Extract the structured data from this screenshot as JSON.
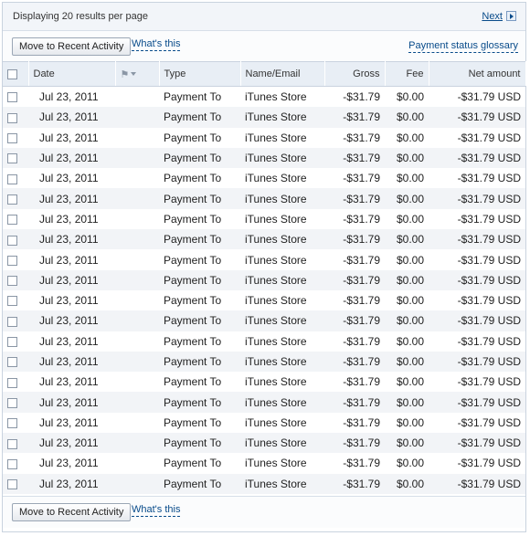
{
  "topbar": {
    "displaying": "Displaying 20 results per page",
    "next": "Next"
  },
  "actions": {
    "move_label": "Move to Recent Activity",
    "whats_this": "What's this",
    "glossary": "Payment status glossary"
  },
  "table": {
    "headers": {
      "date": "Date",
      "type": "Type",
      "name": "Name/Email",
      "gross": "Gross",
      "fee": "Fee",
      "net": "Net amount"
    },
    "rows": [
      {
        "date": "Jul 23, 2011",
        "type": "Payment To",
        "name": "iTunes Store",
        "gross": "-$31.79",
        "fee": "$0.00",
        "net": "-$31.79 USD"
      },
      {
        "date": "Jul 23, 2011",
        "type": "Payment To",
        "name": "iTunes Store",
        "gross": "-$31.79",
        "fee": "$0.00",
        "net": "-$31.79 USD"
      },
      {
        "date": "Jul 23, 2011",
        "type": "Payment To",
        "name": "iTunes Store",
        "gross": "-$31.79",
        "fee": "$0.00",
        "net": "-$31.79 USD"
      },
      {
        "date": "Jul 23, 2011",
        "type": "Payment To",
        "name": "iTunes Store",
        "gross": "-$31.79",
        "fee": "$0.00",
        "net": "-$31.79 USD"
      },
      {
        "date": "Jul 23, 2011",
        "type": "Payment To",
        "name": "iTunes Store",
        "gross": "-$31.79",
        "fee": "$0.00",
        "net": "-$31.79 USD"
      },
      {
        "date": "Jul 23, 2011",
        "type": "Payment To",
        "name": "iTunes Store",
        "gross": "-$31.79",
        "fee": "$0.00",
        "net": "-$31.79 USD"
      },
      {
        "date": "Jul 23, 2011",
        "type": "Payment To",
        "name": "iTunes Store",
        "gross": "-$31.79",
        "fee": "$0.00",
        "net": "-$31.79 USD"
      },
      {
        "date": "Jul 23, 2011",
        "type": "Payment To",
        "name": "iTunes Store",
        "gross": "-$31.79",
        "fee": "$0.00",
        "net": "-$31.79 USD"
      },
      {
        "date": "Jul 23, 2011",
        "type": "Payment To",
        "name": "iTunes Store",
        "gross": "-$31.79",
        "fee": "$0.00",
        "net": "-$31.79 USD"
      },
      {
        "date": "Jul 23, 2011",
        "type": "Payment To",
        "name": "iTunes Store",
        "gross": "-$31.79",
        "fee": "$0.00",
        "net": "-$31.79 USD"
      },
      {
        "date": "Jul 23, 2011",
        "type": "Payment To",
        "name": "iTunes Store",
        "gross": "-$31.79",
        "fee": "$0.00",
        "net": "-$31.79 USD"
      },
      {
        "date": "Jul 23, 2011",
        "type": "Payment To",
        "name": "iTunes Store",
        "gross": "-$31.79",
        "fee": "$0.00",
        "net": "-$31.79 USD"
      },
      {
        "date": "Jul 23, 2011",
        "type": "Payment To",
        "name": "iTunes Store",
        "gross": "-$31.79",
        "fee": "$0.00",
        "net": "-$31.79 USD"
      },
      {
        "date": "Jul 23, 2011",
        "type": "Payment To",
        "name": "iTunes Store",
        "gross": "-$31.79",
        "fee": "$0.00",
        "net": "-$31.79 USD"
      },
      {
        "date": "Jul 23, 2011",
        "type": "Payment To",
        "name": "iTunes Store",
        "gross": "-$31.79",
        "fee": "$0.00",
        "net": "-$31.79 USD"
      },
      {
        "date": "Jul 23, 2011",
        "type": "Payment To",
        "name": "iTunes Store",
        "gross": "-$31.79",
        "fee": "$0.00",
        "net": "-$31.79 USD"
      },
      {
        "date": "Jul 23, 2011",
        "type": "Payment To",
        "name": "iTunes Store",
        "gross": "-$31.79",
        "fee": "$0.00",
        "net": "-$31.79 USD"
      },
      {
        "date": "Jul 23, 2011",
        "type": "Payment To",
        "name": "iTunes Store",
        "gross": "-$31.79",
        "fee": "$0.00",
        "net": "-$31.79 USD"
      },
      {
        "date": "Jul 23, 2011",
        "type": "Payment To",
        "name": "iTunes Store",
        "gross": "-$31.79",
        "fee": "$0.00",
        "net": "-$31.79 USD"
      },
      {
        "date": "Jul 23, 2011",
        "type": "Payment To",
        "name": "iTunes Store",
        "gross": "-$31.79",
        "fee": "$0.00",
        "net": "-$31.79 USD"
      }
    ]
  },
  "icons": {
    "next": "chevron-right-icon",
    "flag": "flag-icon",
    "caret": "chevron-down-icon"
  },
  "colors": {
    "link": "#084b8a",
    "header_bg": "#e8eef5",
    "row_alt": "#f2f4f7"
  }
}
